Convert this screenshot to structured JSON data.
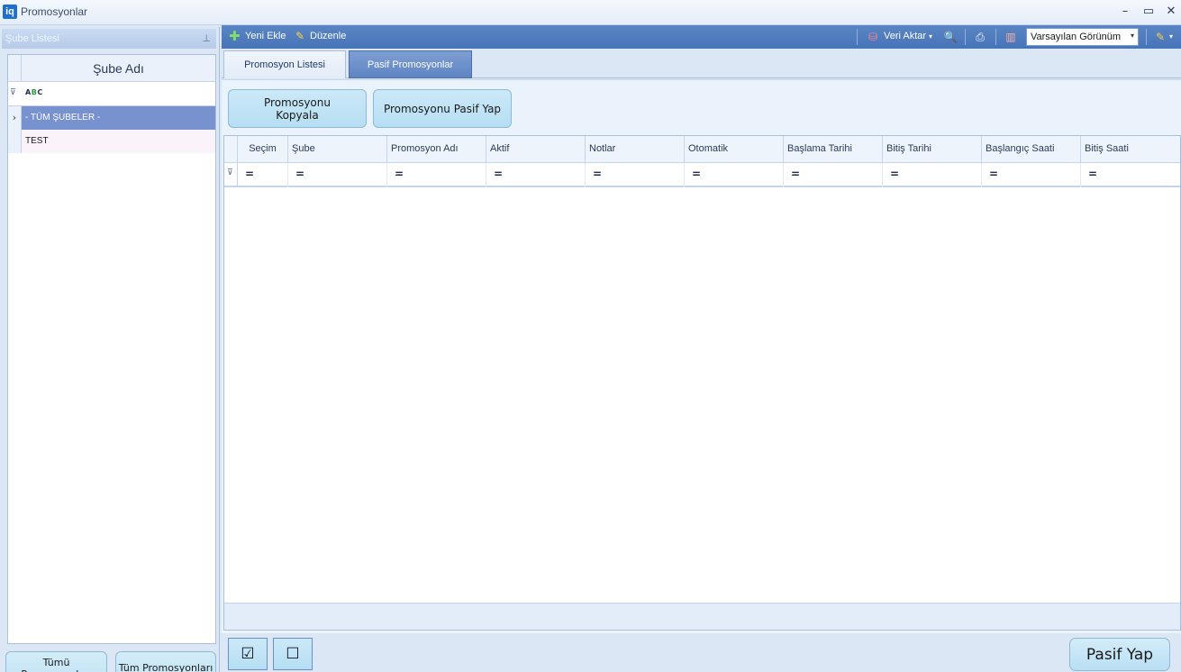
{
  "window": {
    "logo": "iq",
    "title": "Promosyonlar",
    "controls": {
      "minimize": "–",
      "maximize": "▭",
      "close": "✕"
    }
  },
  "branch_panel": {
    "header": "Şube Listesi",
    "pin_icon": "⊥",
    "column_header": "Şube Adı",
    "filter_icon": "⊽",
    "abc_icon": "ABC",
    "rows": [
      {
        "indicator": "›",
        "label": "- TÜM ŞUBELER -"
      },
      {
        "indicator": "",
        "label": "TEST"
      }
    ]
  },
  "left_buttons": {
    "all_passive": "Tümü Promosyonları\nPasif Yap",
    "all_active": "Tüm Promosyonları\nAktif Yap"
  },
  "toolbar": {
    "add_icon": "✚",
    "add_label": "Yeni Ekle",
    "edit_icon": "✎",
    "edit_label": "Düzenle",
    "export_icon": "⛁",
    "export_label": "Veri Aktar",
    "export_caret": "▾",
    "preview_icon": "🔍",
    "print_icon": "⎙",
    "layout_icon": "▥",
    "view_select_value": "Varsayılan Görünüm",
    "view_select_arrow": "▾",
    "customize_icon": "✎",
    "customize_caret": "▾"
  },
  "tabs": [
    {
      "label": "Promosyon Listesi",
      "active": false
    },
    {
      "label": "Pasif Promosyonlar",
      "active": true
    }
  ],
  "actions": {
    "copy_label": "Promosyonu\nKopyala",
    "deactivate_label": "Promosyonu Pasif Yap"
  },
  "grid": {
    "filter_icon": "⊽",
    "filter_operator": "=",
    "columns": [
      "Seçim",
      "Şube",
      "Promosyon Adı",
      "Aktif",
      "Notlar",
      "Otomatik",
      "Başlama Tarihi",
      "Bitiş Tarihi",
      "Başlangıç Saati",
      "Bitiş Saati"
    ],
    "rows": []
  },
  "bottom": {
    "check_all_icon": "☑",
    "uncheck_all_icon": "☐",
    "submit_label": "Pasif Yap"
  },
  "colors": {
    "toolbar": "#4f7bbf",
    "selected_row": "#7892cf",
    "button_bg": "#bfe3f5",
    "panel_bg": "#dbe7f5"
  }
}
